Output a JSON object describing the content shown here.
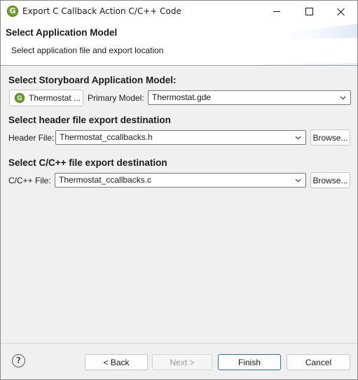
{
  "window": {
    "title": "Export C Callback Action C/C++ Code",
    "app_icon_glyph": "G",
    "accent_color": "#6aa12a"
  },
  "banner": {
    "title": "Select Application Model",
    "subtitle": "Select application file and export location"
  },
  "model_section": {
    "title": "Select Storyboard Application Model:",
    "model_button_label": "Thermostat ...",
    "primary_model_label": "Primary Model:",
    "primary_model_value": "Thermostat.gde"
  },
  "header_section": {
    "title": "Select header file export destination",
    "field_label": "Header File:",
    "field_value": "Thermostat_ccallbacks.h",
    "browse_label": "Browse..."
  },
  "cpp_section": {
    "title": "Select C/C++ file export destination",
    "field_label": "C/C++ File:",
    "field_value": "Thermostat_ccallbacks.c",
    "browse_label": "Browse..."
  },
  "footer": {
    "help_glyph": "?",
    "back_label": "< Back",
    "next_label": "Next >",
    "finish_label": "Finish",
    "cancel_label": "Cancel"
  }
}
